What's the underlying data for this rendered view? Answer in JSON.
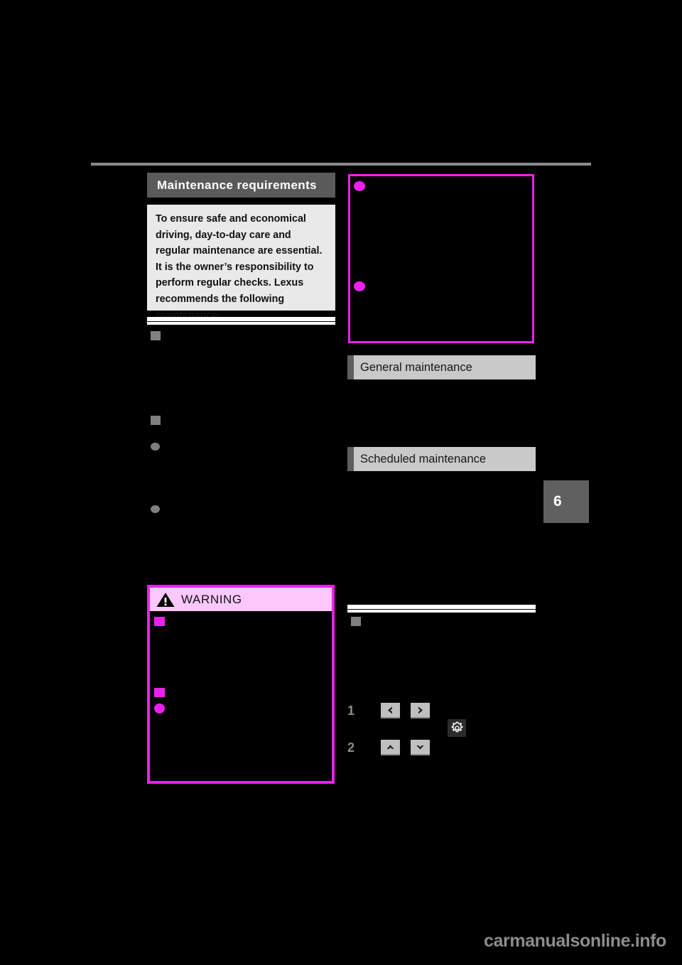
{
  "page": {
    "background": "#000000",
    "chapter_number": "6",
    "watermark": "carmanualsonline.info"
  },
  "left_column": {
    "section_title": "Maintenance requirements",
    "intro_text": "To ensure safe and economical driving, day-to-day care and regular maintenance are essential. It is the owner’s responsibility to perform regular checks. Lexus recommends the following maintenance:",
    "warning": {
      "label": "WARNING",
      "icon": "warning-triangle-icon",
      "border_color": "#f01ef0",
      "header_color": "#fcc8fc"
    }
  },
  "right_column": {
    "headings": [
      {
        "label": "General maintenance"
      },
      {
        "label": "Scheduled maintenance"
      }
    ],
    "callout_box": {
      "border_color": "#f01ef0",
      "bullets": 2
    },
    "steps": [
      {
        "number": "1",
        "buttons": [
          {
            "icon": "chevron-left-icon",
            "glyph": "‹"
          },
          {
            "icon": "chevron-right-icon",
            "glyph": "›"
          }
        ]
      },
      {
        "number": "2",
        "buttons": [
          {
            "icon": "chevron-up-icon",
            "glyph": "˄"
          },
          {
            "icon": "chevron-down-icon",
            "glyph": "˅"
          }
        ]
      }
    ],
    "gear_button": {
      "icon": "gear-icon"
    }
  },
  "colors": {
    "title_bar": "#5a5a5a",
    "grey_heading": "#c9c9c9",
    "accent_magenta": "#f01ef0",
    "intro_bg": "#e9e9e9",
    "bullet_grey": "#808080"
  }
}
